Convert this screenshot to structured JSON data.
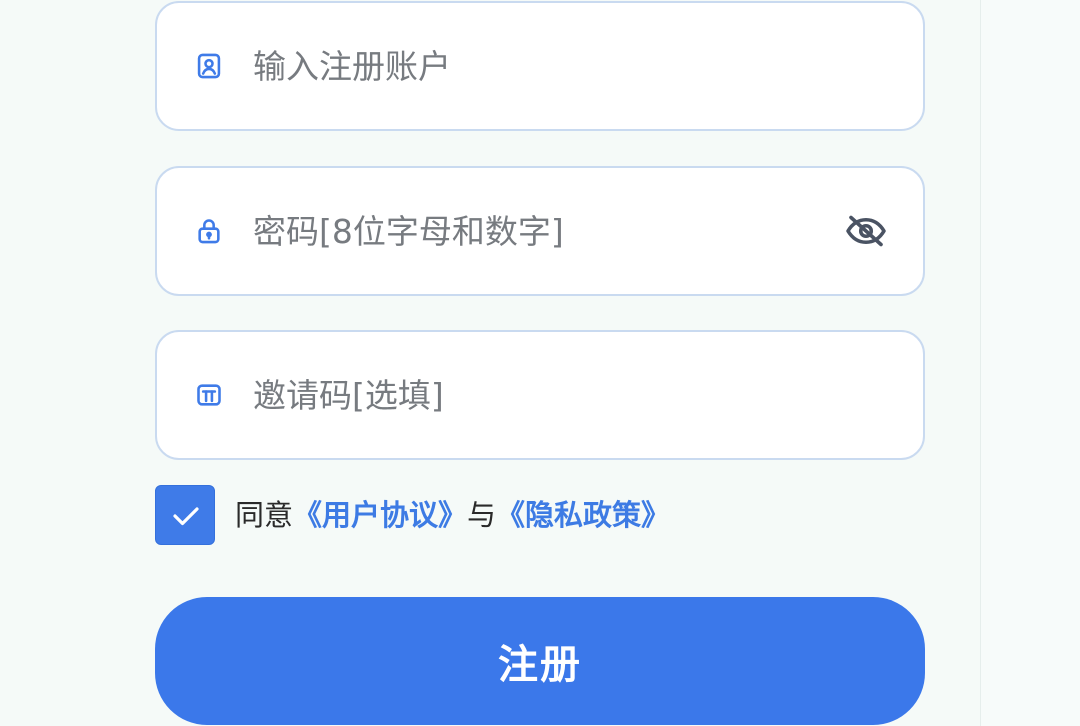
{
  "form": {
    "account": {
      "placeholder": "输入注册账户",
      "value": "",
      "icon": "id-card-icon"
    },
    "password": {
      "placeholder": "密码[8位字母和数字]",
      "value": "",
      "icon": "lock-icon",
      "toggle_icon": "eye-off-icon"
    },
    "invite": {
      "placeholder": "邀请码[选填]",
      "value": "",
      "icon": "gift-icon"
    }
  },
  "agreement": {
    "checked": true,
    "prefix": "同意",
    "terms_link": "《用户协议》",
    "joiner": "与",
    "privacy_link": "《隐私政策》"
  },
  "submit_label": "注册",
  "colors": {
    "primary": "#3b78ea",
    "link": "#3d7be4",
    "field_border": "#c9daf0",
    "background": "#f5faf8"
  }
}
